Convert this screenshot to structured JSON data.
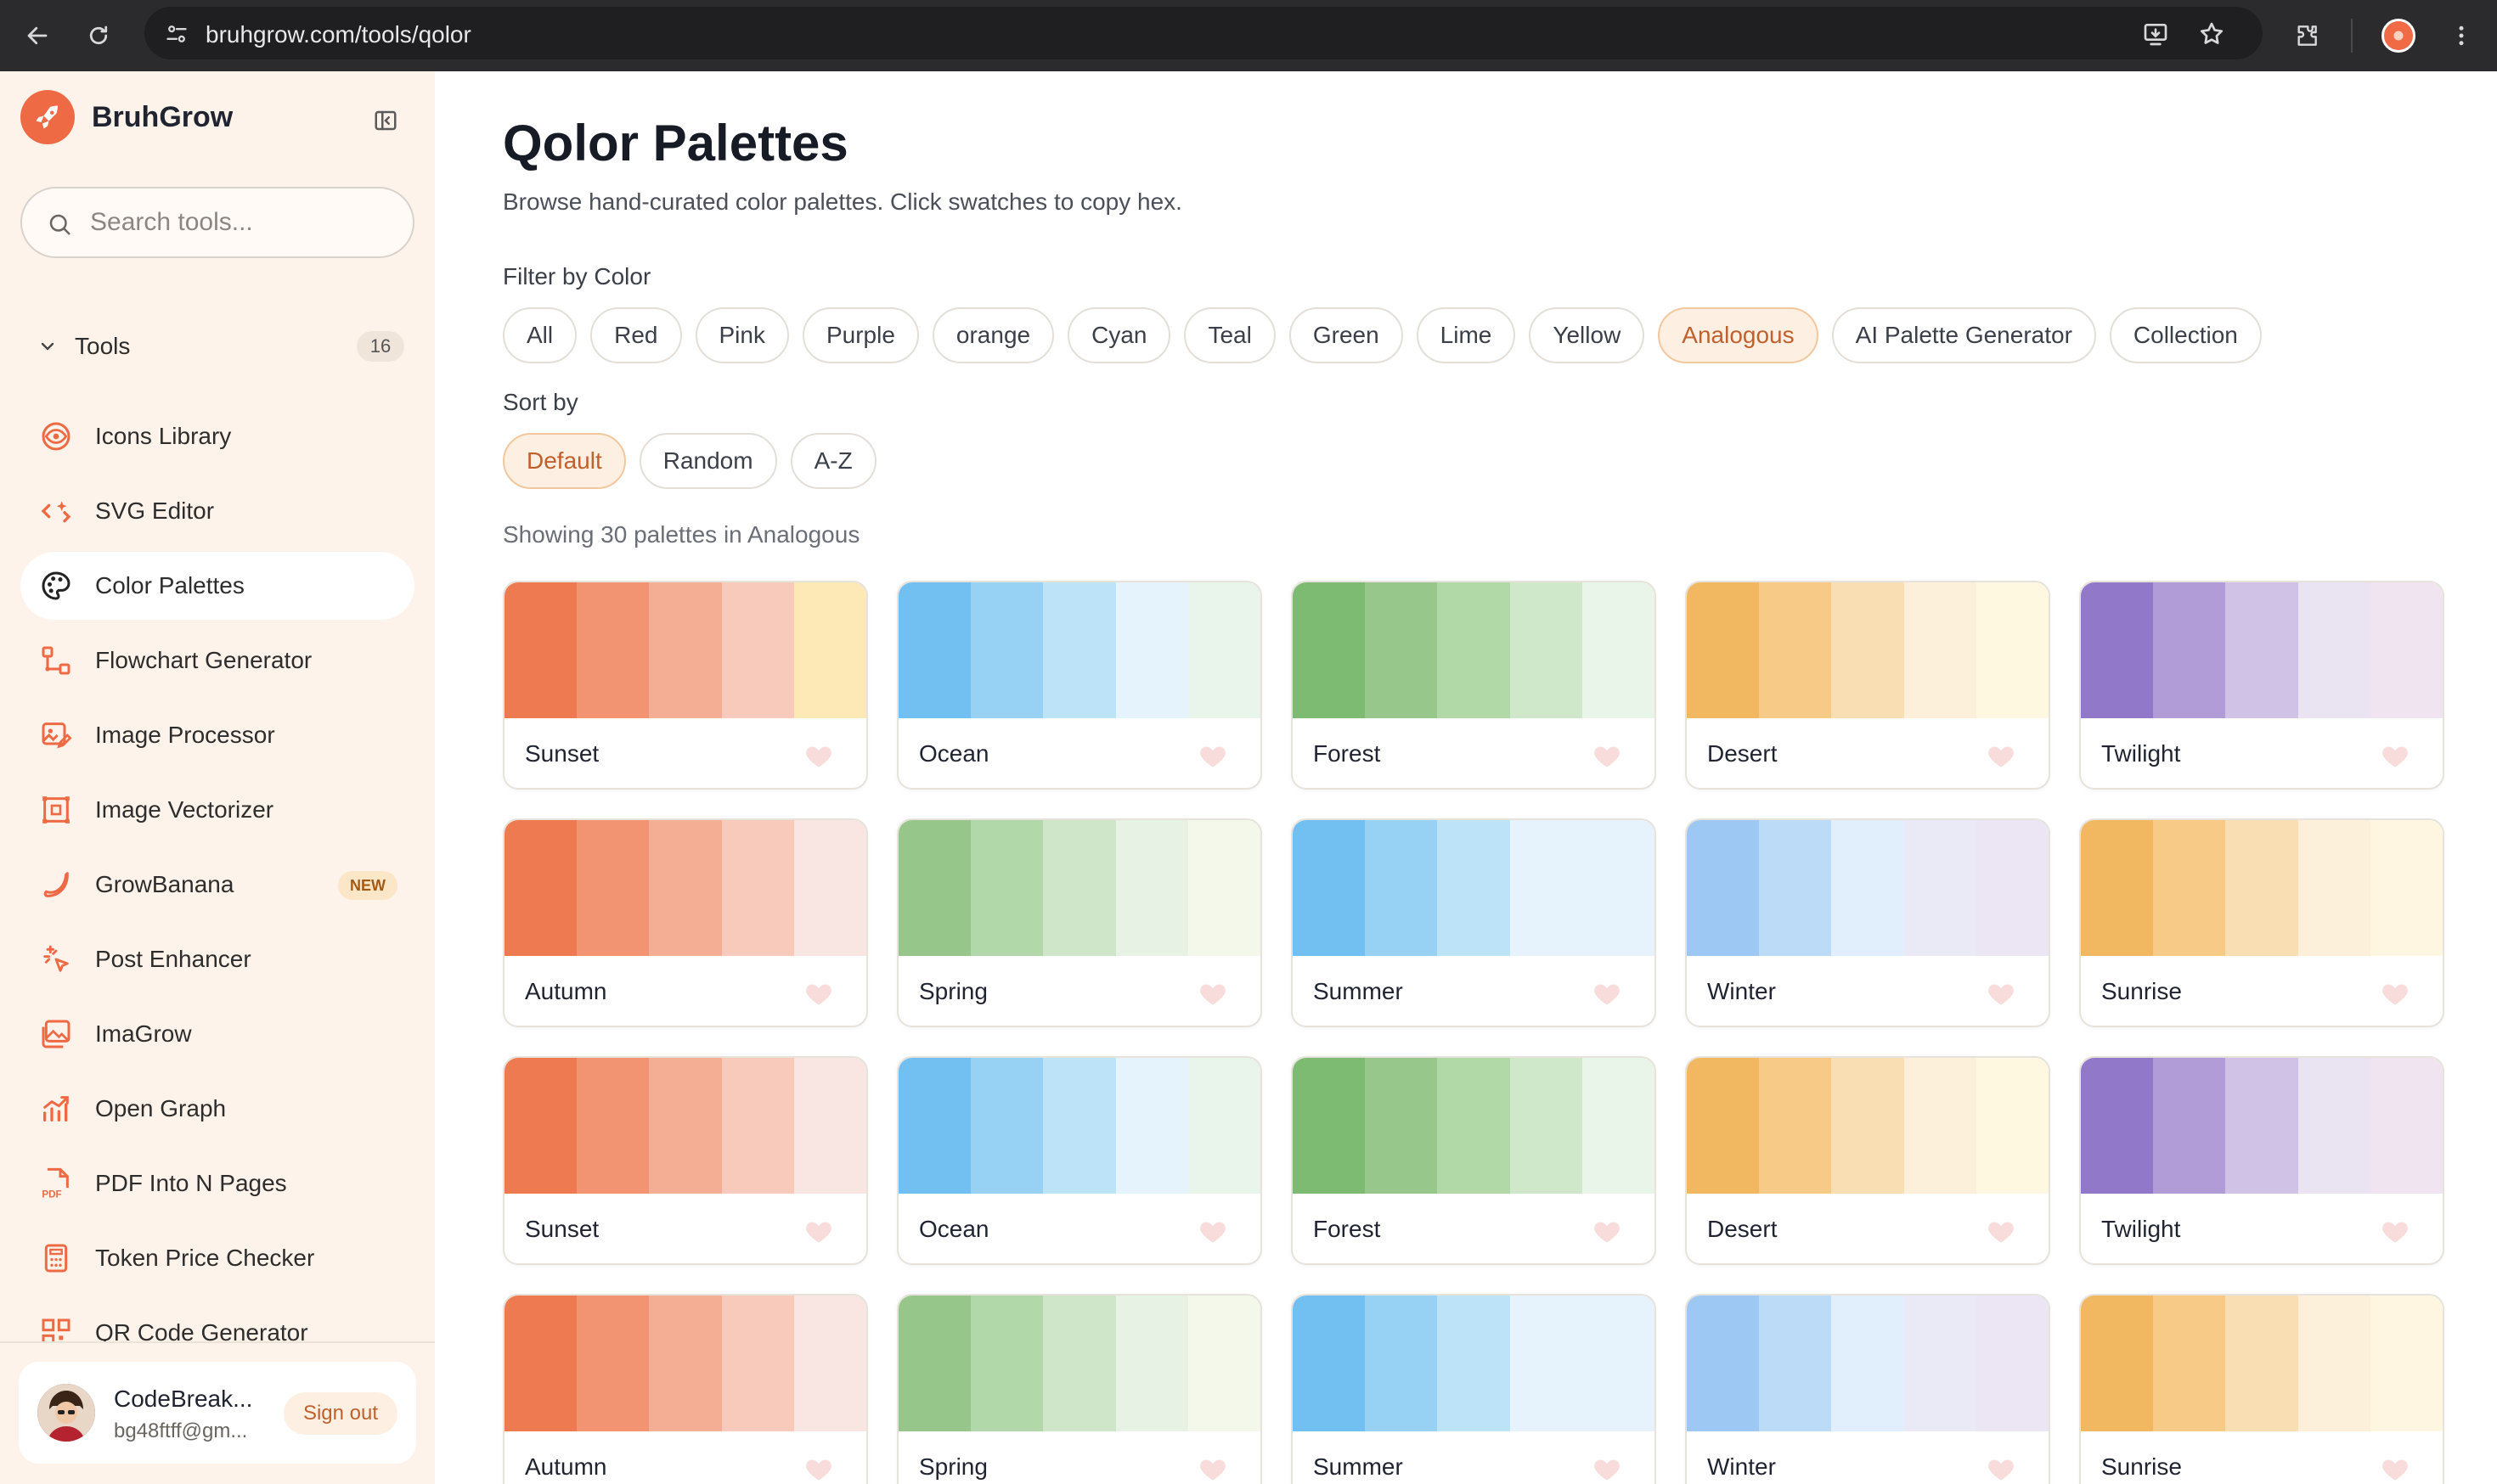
{
  "browser": {
    "url": "bruhgrow.com/tools/qolor"
  },
  "sidebar": {
    "brand": "BruhGrow",
    "search_placeholder": "Search tools...",
    "tools_label": "Tools",
    "tools_count": "16",
    "items": [
      {
        "label": "Icons Library",
        "icon": "eye-icon"
      },
      {
        "label": "SVG Editor",
        "icon": "code-sparkle-icon"
      },
      {
        "label": "Color Palettes",
        "icon": "palette-icon",
        "active": true
      },
      {
        "label": "Flowchart Generator",
        "icon": "flowchart-icon"
      },
      {
        "label": "Image Processor",
        "icon": "image-edit-icon"
      },
      {
        "label": "Image Vectorizer",
        "icon": "vectorize-icon"
      },
      {
        "label": "GrowBanana",
        "icon": "banana-icon",
        "badge": "NEW"
      },
      {
        "label": "Post Enhancer",
        "icon": "sparkle-cursor-icon"
      },
      {
        "label": "ImaGrow",
        "icon": "gallery-icon"
      },
      {
        "label": "Open Graph",
        "icon": "chart-up-icon"
      },
      {
        "label": "PDF Into N Pages",
        "icon": "pdf-icon"
      },
      {
        "label": "Token Price Checker",
        "icon": "calculator-icon"
      },
      {
        "label": "QR Code Generator",
        "icon": "qr-icon"
      }
    ],
    "user": {
      "name": "CodeBreak...",
      "email": "bg48ftff@gm...",
      "signout_label": "Sign out"
    }
  },
  "main": {
    "title": "Qolor Palettes",
    "subtitle": "Browse hand-curated color palettes. Click swatches to copy hex.",
    "filter_label": "Filter by Color",
    "filters": [
      "All",
      "Red",
      "Pink",
      "Purple",
      "orange",
      "Cyan",
      "Teal",
      "Green",
      "Lime",
      "Yellow",
      "Analogous",
      "AI Palette Generator",
      "Collection"
    ],
    "active_filter": "Analogous",
    "sort_label": "Sort by",
    "sorts": [
      "Default",
      "Random",
      "A-Z"
    ],
    "active_sort": "Default",
    "showing_text": "Showing 30 palettes in Analogous",
    "palettes": [
      {
        "name": "Sunset",
        "colors": [
          "#EE7A52",
          "#F29372",
          "#F4AE94",
          "#F8CABC",
          "#FCE9B5"
        ]
      },
      {
        "name": "Ocean",
        "colors": [
          "#72C0F1",
          "#97D2F5",
          "#BDE3F8",
          "#E5F3FC",
          "#E9F4EA"
        ]
      },
      {
        "name": "Forest",
        "colors": [
          "#7EBB72",
          "#97C78A",
          "#B1D9A8",
          "#D0E8CA",
          "#E9F5E8"
        ]
      },
      {
        "name": "Desert",
        "colors": [
          "#F2B861",
          "#F7CB87",
          "#F9DEB3",
          "#FCF0DB",
          "#FEF8E1"
        ]
      },
      {
        "name": "Twilight",
        "colors": [
          "#9178C8",
          "#B19CD8",
          "#D0C2E6",
          "#EAE3F2",
          "#F1E4F1"
        ]
      },
      {
        "name": "Autumn",
        "colors": [
          "#EE7A52",
          "#F29372",
          "#F4AE94",
          "#F8CABC",
          "#F9E6E2"
        ]
      },
      {
        "name": "Spring",
        "colors": [
          "#96C68A",
          "#B1D8A8",
          "#CFE6C9",
          "#E7F2E4",
          "#F3F8EB"
        ]
      },
      {
        "name": "Summer",
        "colors": [
          "#72C0F1",
          "#97D2F5",
          "#BDE3F8",
          "#E6F2FC",
          "#E6F2FC"
        ]
      },
      {
        "name": "Winter",
        "colors": [
          "#9CC8F3",
          "#BCDBF7",
          "#E1EEFB",
          "#E9EAF6",
          "#ECE6F4"
        ]
      },
      {
        "name": "Sunrise",
        "colors": [
          "#F2B861",
          "#F7CB87",
          "#F9DEB3",
          "#FCF0DB",
          "#FEF6E0"
        ]
      },
      {
        "name": "Sunset",
        "colors": [
          "#EE7A52",
          "#F29372",
          "#F4AE94",
          "#F8CABC",
          "#F9E6E2"
        ]
      },
      {
        "name": "Ocean",
        "colors": [
          "#72C0F1",
          "#97D2F5",
          "#BDE3F8",
          "#E5F3FC",
          "#E9F4EA"
        ]
      },
      {
        "name": "Forest",
        "colors": [
          "#7EBB72",
          "#97C78A",
          "#B1D9A8",
          "#D0E8CA",
          "#E9F5E8"
        ]
      },
      {
        "name": "Desert",
        "colors": [
          "#F2B861",
          "#F7CB87",
          "#F9DEB3",
          "#FCF0DB",
          "#FEF8E1"
        ]
      },
      {
        "name": "Twilight",
        "colors": [
          "#9178C8",
          "#B19CD8",
          "#D0C2E6",
          "#EAE3F2",
          "#F1E4F1"
        ]
      },
      {
        "name": "Autumn",
        "colors": [
          "#EE7A52",
          "#F29372",
          "#F4AE94",
          "#F8CABC",
          "#F9E6E2"
        ]
      },
      {
        "name": "Spring",
        "colors": [
          "#96C68A",
          "#B1D8A8",
          "#CFE6C9",
          "#E7F2E4",
          "#F3F8EB"
        ]
      },
      {
        "name": "Summer",
        "colors": [
          "#72C0F1",
          "#97D2F5",
          "#BDE3F8",
          "#E6F2FC",
          "#E6F2FC"
        ]
      },
      {
        "name": "Winter",
        "colors": [
          "#9CC8F3",
          "#BCDBF7",
          "#E1EEFB",
          "#E9EAF6",
          "#ECE6F4"
        ]
      },
      {
        "name": "Sunrise",
        "colors": [
          "#F2B861",
          "#F7CB87",
          "#F9DEB3",
          "#FCF0DB",
          "#FEF6E0"
        ]
      }
    ]
  },
  "colors": {
    "accent": "#EE6A45",
    "sidebar_bg": "#FDF3EA",
    "heart": "#F8DCDC"
  }
}
